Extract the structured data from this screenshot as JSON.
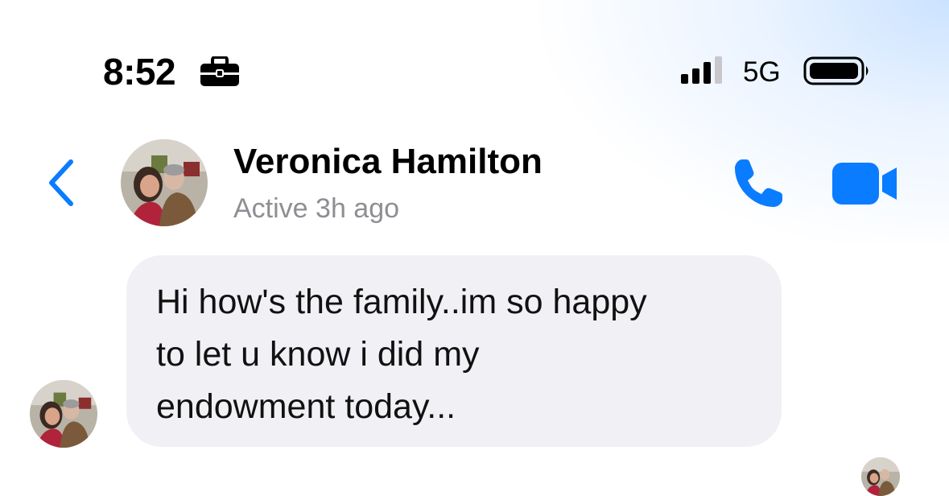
{
  "status_bar": {
    "time": "8:52",
    "focus_icon": "briefcase-icon",
    "signal_icon": "cellular-signal-icon",
    "network": "5G",
    "battery_icon": "battery-icon"
  },
  "header": {
    "back_icon": "chevron-left-icon",
    "contact_name": "Veronica Hamilton",
    "status": "Active 3h ago",
    "call_icon": "phone-icon",
    "video_icon": "video-camera-icon"
  },
  "conversation": {
    "messages": [
      {
        "sender": "Veronica Hamilton",
        "text": "Hi how's the family..im so happy\nto let u know i did my\nendowment today..."
      }
    ]
  },
  "colors": {
    "accent": "#0a7cff",
    "bubble_incoming": "#f1f1f5",
    "secondary_text": "#8e8e93"
  }
}
